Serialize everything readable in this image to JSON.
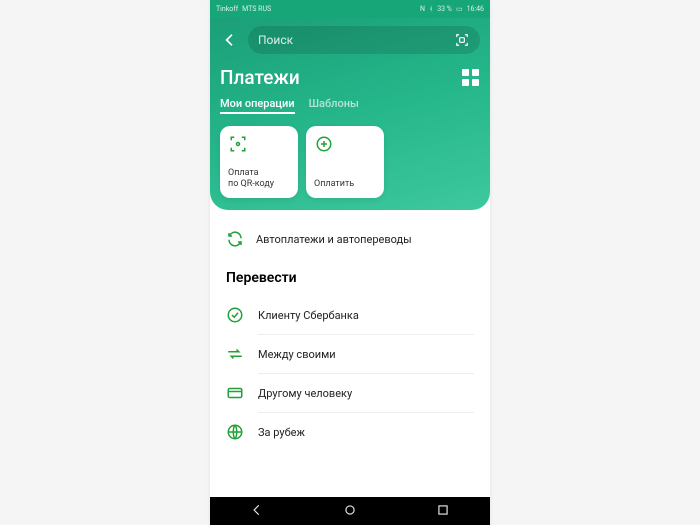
{
  "status": {
    "left_text": "Tinkoff",
    "carrier": "MTS RUS",
    "icons_right": "N ⟦33 %⟧",
    "battery": "33 %",
    "time": "16:46",
    "nfc": "N"
  },
  "header": {
    "search_placeholder": "Поиск",
    "page_title": "Платежи",
    "tabs": [
      {
        "label": "Мои операции",
        "active": true
      },
      {
        "label": "Шаблоны",
        "active": false
      }
    ],
    "cards": [
      {
        "label": "Оплата\nпо QR-коду"
      },
      {
        "label": "Оплатить"
      }
    ]
  },
  "autopay_label": "Автоплатежи и автопереводы",
  "transfer_section": {
    "title": "Перевести",
    "items": [
      {
        "label": "Клиенту Сбербанка",
        "icon": "checkmark"
      },
      {
        "label": "Между своими",
        "icon": "arrows"
      },
      {
        "label": "Другому человеку",
        "icon": "card"
      },
      {
        "label": "За рубеж",
        "icon": "globe"
      }
    ]
  },
  "colors": {
    "brand_green": "#21a038",
    "header_grad": "#1b9f78"
  }
}
